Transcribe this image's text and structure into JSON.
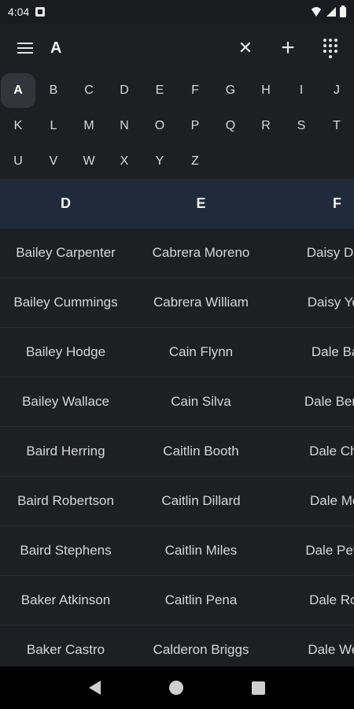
{
  "status": {
    "time": "4:04"
  },
  "toolbar": {
    "title": "A",
    "close_icon": "✕",
    "add_icon": "+"
  },
  "alphabet": {
    "selected": "A",
    "letters": [
      "A",
      "B",
      "C",
      "D",
      "E",
      "F",
      "G",
      "H",
      "I",
      "J",
      "K",
      "L",
      "M",
      "N",
      "O",
      "P",
      "Q",
      "R",
      "S",
      "T",
      "U",
      "V",
      "W",
      "X",
      "Y",
      "Z"
    ]
  },
  "columns": [
    "D",
    "E",
    "F"
  ],
  "rows": [
    [
      "Bailey Carpenter",
      "Cabrera Moreno",
      "Daisy Duc"
    ],
    [
      "Bailey Cummings",
      "Cabrera William",
      "Daisy You"
    ],
    [
      "Bailey Hodge",
      "Cain Flynn",
      "Dale Bat"
    ],
    [
      "Bailey Wallace",
      "Cain Silva",
      "Dale Benja"
    ],
    [
      "Baird Herring",
      "Caitlin Booth",
      "Dale Che"
    ],
    [
      "Baird Robertson",
      "Caitlin Dillard",
      "Dale Mor"
    ],
    [
      "Baird Stephens",
      "Caitlin Miles",
      "Dale Peter"
    ],
    [
      "Baker Atkinson",
      "Caitlin Pena",
      "Dale Roa"
    ],
    [
      "Baker Castro",
      "Calderon Briggs",
      "Dale Wee"
    ]
  ],
  "colors": {
    "background": "#1e1f23",
    "header": "#1f2b3a",
    "selected_letter": "#33353a"
  }
}
